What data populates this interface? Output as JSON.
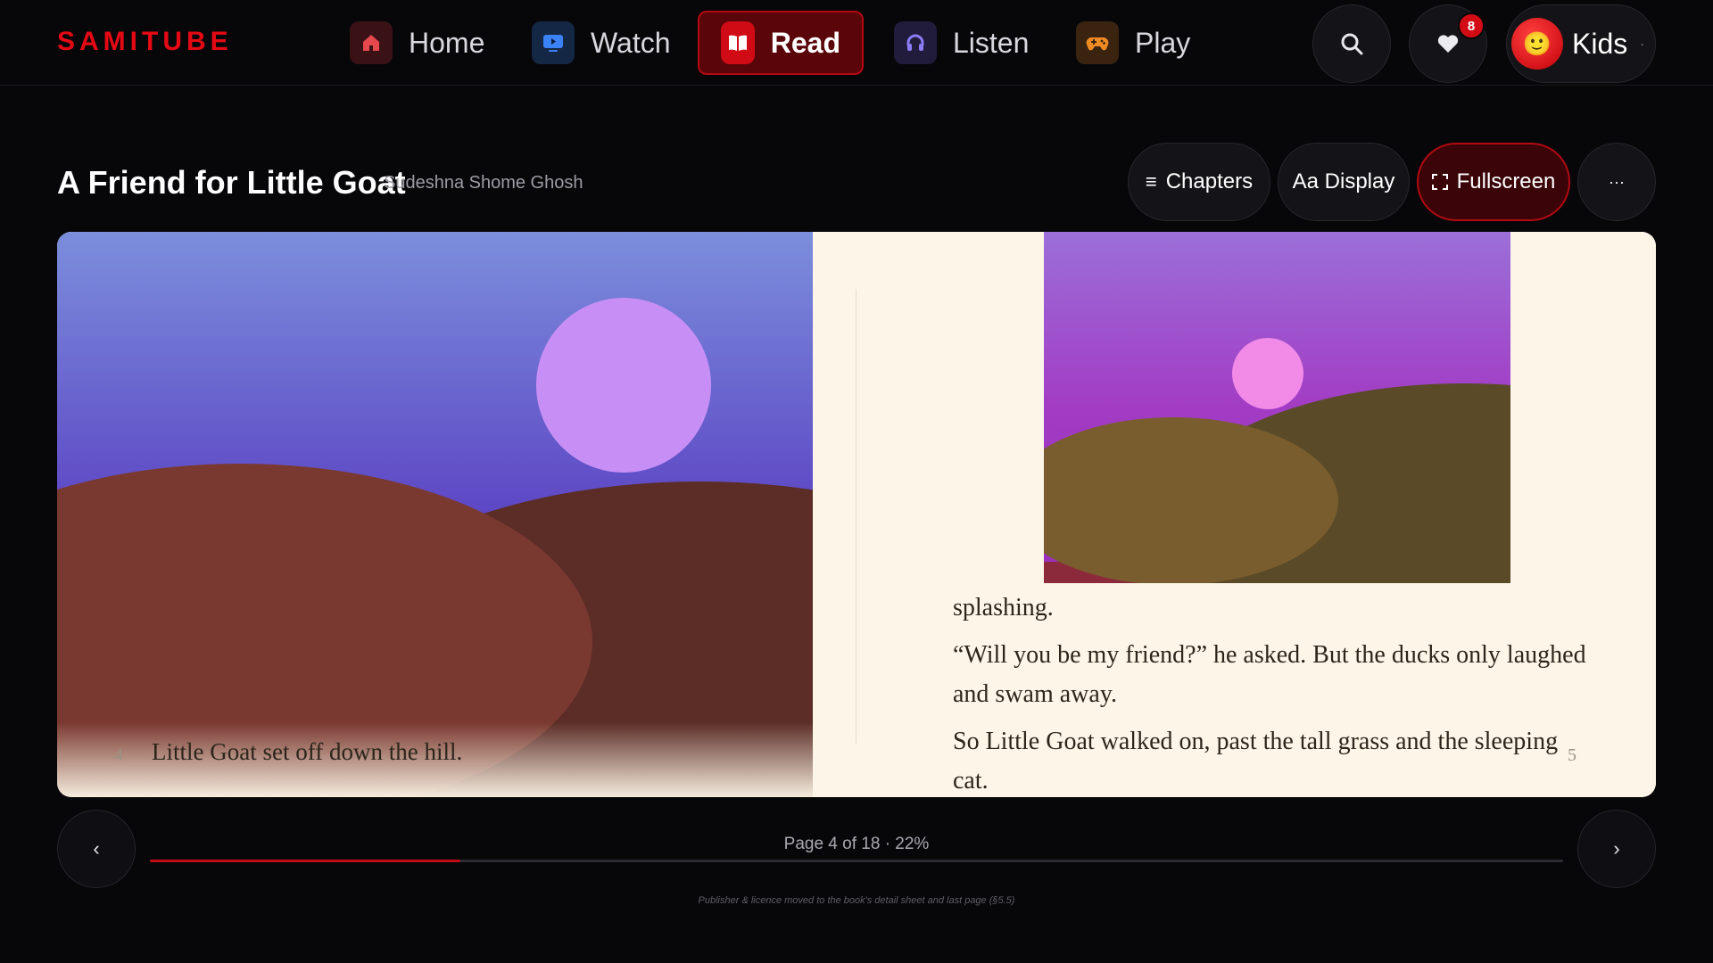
{
  "header": {
    "logo": "SAMITUBE",
    "nav": [
      {
        "label": "Home",
        "icon": "home-icon",
        "color": "#e5484d"
      },
      {
        "label": "Watch",
        "icon": "tv-icon",
        "color": "#3b82f6"
      },
      {
        "label": "Read",
        "icon": "book-icon",
        "color": "#ffffff",
        "active": true
      },
      {
        "label": "Listen",
        "icon": "headphones-icon",
        "color": "#8b7cf6"
      },
      {
        "label": "Play",
        "icon": "gamepad-icon",
        "color": "#f08a24"
      }
    ],
    "favorites_count": "8",
    "profile": {
      "name": "Kids",
      "avatar": "🙂",
      "menu_glyph": "·"
    }
  },
  "book": {
    "title": "A Friend for Little Goat",
    "author": "Sudeshna Shome Ghosh"
  },
  "toolbar": {
    "chapters_label": "Chapters",
    "chapters_glyph": "≡",
    "display_label": "Aa Display",
    "fullscreen_label": "Fullscreen",
    "more_glyph": "···"
  },
  "spread": {
    "left_page_number": "4",
    "left_text": "Little Goat set off down the hill.",
    "right_page_number": "5",
    "right_paragraphs": [
      "splashing.",
      "“Will you be my friend?” he asked. But the ducks only laughed and swam away.",
      "So Little Goat walked on, past the tall grass and the sleeping cat."
    ]
  },
  "pager": {
    "prev_glyph": "‹",
    "next_glyph": "›",
    "label": "Page 4 of 18 · 22%",
    "progress_percent": 22
  },
  "footer_note": "Publisher & licence moved to the book's detail sheet and last page (§5.5)",
  "colors": {
    "brand": "#e50914",
    "accent": "#c20b14",
    "background": "#07070a",
    "paper": "#fdf6e8"
  }
}
